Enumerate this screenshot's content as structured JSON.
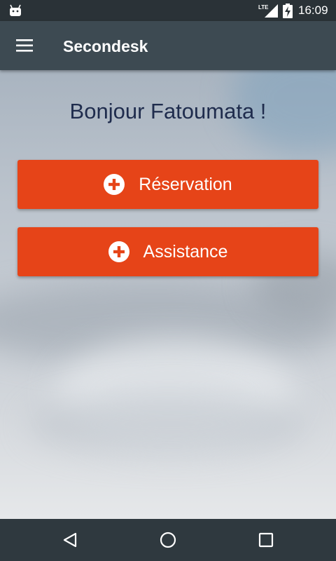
{
  "status_bar": {
    "time": "16:09",
    "network_label": "LTE",
    "icons": [
      "android-icon",
      "lte-signal-icon",
      "battery-charging-icon"
    ]
  },
  "app_bar": {
    "title": "Secondesk",
    "menu_icon": "hamburger-menu-icon"
  },
  "main": {
    "greeting": "Bonjour Fatoumata !",
    "buttons": [
      {
        "label": "Réservation",
        "icon": "plus-circle-icon"
      },
      {
        "label": "Assistance",
        "icon": "plus-circle-icon"
      }
    ]
  },
  "nav_bar": {
    "icons": [
      "back-icon",
      "home-icon",
      "recent-apps-icon"
    ]
  },
  "colors": {
    "status_bar": "#2a3237",
    "app_bar": "#3d4a52",
    "accent_button": "#e64418",
    "greeting_text": "#1f2c4d",
    "nav_bar": "#2f393f"
  }
}
